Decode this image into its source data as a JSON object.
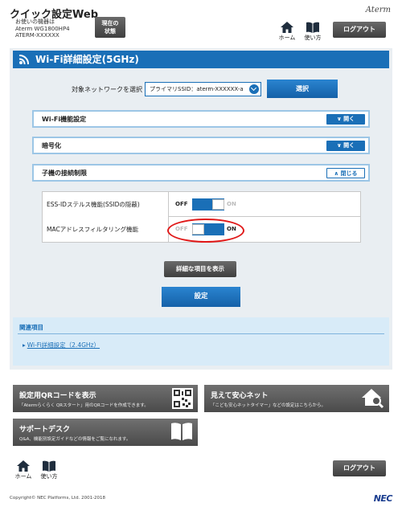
{
  "header": {
    "app_title": "クイック設定Web",
    "device_info": {
      "line1": "お使いの機器は",
      "line2": "Aterm WG1800HP4",
      "line3": "ATERM-XXXXXX"
    },
    "status_button": {
      "line1": "現在の",
      "line2": "状態"
    },
    "brand": "Aterm",
    "home_label": "ホーム",
    "help_label": "使い方",
    "logout_label": "ログアウト"
  },
  "main": {
    "section_title": "Wi-Fi詳細設定(5GHz)",
    "network_select_label": "対象ネットワークを選択",
    "network_select_value": "プライマリSSID：aterm-XXXXXX-a",
    "select_button": "選択",
    "accordions": [
      {
        "label": "Wi-Fi機能設定",
        "button": "開く"
      },
      {
        "label": "暗号化",
        "button": "開く"
      },
      {
        "label": "子機の接続制限",
        "button": "閉じる"
      }
    ],
    "settings": [
      {
        "label": "ESS-IDステルス機能(SSIDの隠蔽)",
        "off": "OFF",
        "on": "ON",
        "state": "off"
      },
      {
        "label": "MACアドレスフィルタリング機能",
        "off": "OFF",
        "on": "ON",
        "state": "on"
      }
    ],
    "detail_button": "詳細な項目を表示",
    "set_button": "設定",
    "related": {
      "title": "関連項目",
      "link": "Wi-Fi詳細設定（2.4GHz）"
    }
  },
  "tiles": [
    {
      "title": "設定用QRコードを表示",
      "desc": "「Atermらくらく QRスタート」用のQRコードを作成できます。",
      "icon": "qr-code-icon"
    },
    {
      "title": "見えて安心ネット",
      "desc": "「こども安心ネットタイマー」などの設定はこちらから。",
      "icon": "home-search-icon"
    },
    {
      "title": "サポートデスク",
      "desc": "Q&A、機能別設定ガイドなどの情報をご覧になれます。",
      "icon": "book-icon"
    }
  ],
  "footer": {
    "home_label": "ホーム",
    "help_label": "使い方",
    "logout_label": "ログアウト",
    "copyright": "Copyright© NEC Platforms, Ltd. 2001-2018",
    "nec_logo": "NEC"
  },
  "colors": {
    "primary_blue": "#1a6fb7",
    "panel_bg": "#e9eef2",
    "highlight_red": "#e01818"
  }
}
